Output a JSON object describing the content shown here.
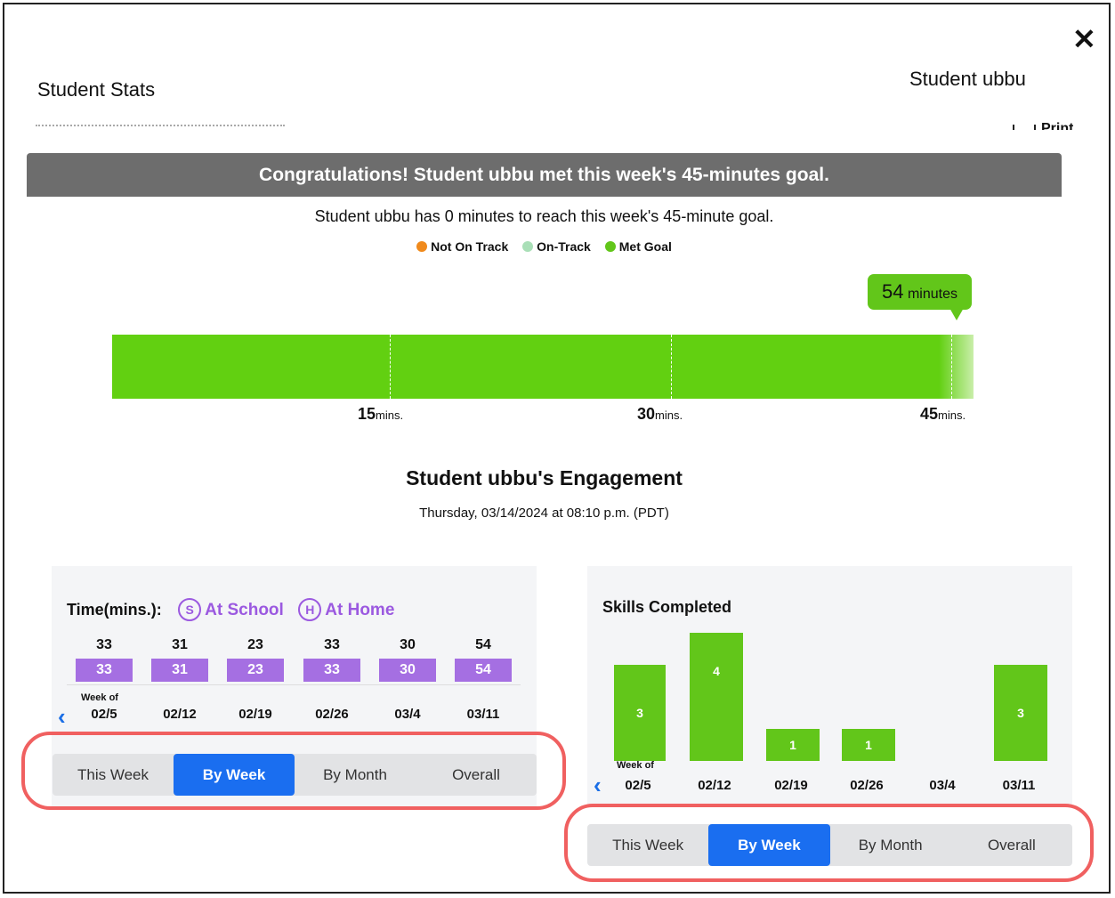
{
  "modal": {
    "title": "Student Stats",
    "student_name": "Student ubbu",
    "print_label": "Print"
  },
  "goal": {
    "banner": "Congratulations! Student ubbu met this week's 45-minutes goal.",
    "subtitle": "Student ubbu has 0 minutes to reach this week's 45-minute goal.",
    "legend": [
      {
        "label": "Not On Track",
        "color": "#f08a1c"
      },
      {
        "label": "On-Track",
        "color": "#a9dfb7"
      },
      {
        "label": "Met Goal",
        "color": "#62c61a"
      }
    ],
    "callout_value": "54",
    "callout_unit": "minutes",
    "progress_minutes": 54,
    "goal_minutes": 45,
    "ticks": [
      {
        "value": "15",
        "unit": "mins."
      },
      {
        "value": "30",
        "unit": "mins."
      },
      {
        "value": "45",
        "unit": "mins."
      }
    ]
  },
  "engagement": {
    "title": "Student ubbu's Engagement",
    "date": "Thursday, 03/14/2024 at 08:10 p.m. (PDT)"
  },
  "time_panel": {
    "label": "Time(mins.):",
    "at_school_letter": "S",
    "at_school": "At School",
    "at_home_letter": "H",
    "at_home": "At Home",
    "week_of": "Week of",
    "totals": [
      "33",
      "31",
      "23",
      "33",
      "30",
      "54"
    ],
    "school_values": [
      "33",
      "31",
      "23",
      "33",
      "30",
      "54"
    ],
    "weeks": [
      "02/5",
      "02/12",
      "02/19",
      "02/26",
      "03/4",
      "03/11"
    ],
    "tabs": [
      "This Week",
      "By Week",
      "By Month",
      "Overall"
    ],
    "active_tab": "By Week"
  },
  "skills_panel": {
    "label": "Skills Completed",
    "week_of": "Week of",
    "values": [
      "3",
      "4",
      "1",
      "1",
      "",
      "3"
    ],
    "weeks": [
      "02/5",
      "02/12",
      "02/19",
      "02/26",
      "03/4",
      "03/11"
    ],
    "tabs": [
      "This Week",
      "By Week",
      "By Month",
      "Overall"
    ],
    "active_tab": "By Week"
  }
}
